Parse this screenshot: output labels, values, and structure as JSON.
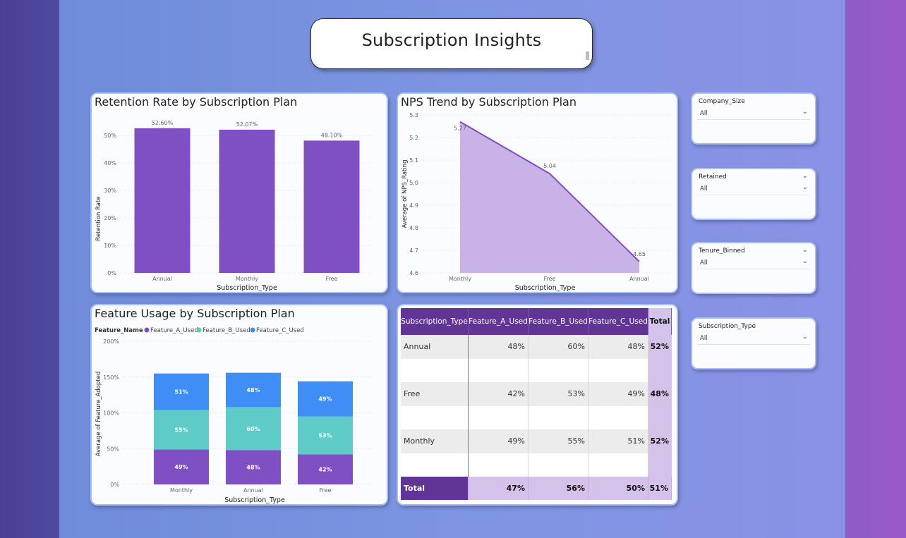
{
  "page_title": "Subscription Insights",
  "colors": {
    "purple": "#7f4fc4",
    "teal": "#5ecbc6",
    "blue": "#3f8ef6",
    "header": "#613596",
    "total": "#d4c2ea",
    "area": "#c8b2e6"
  },
  "retention": {
    "title": "Retention Rate by Subscription Plan",
    "chart_data": {
      "type": "bar",
      "categories": [
        "Annual",
        "Monthly",
        "Free"
      ],
      "values": [
        52.6,
        52.07,
        48.1
      ],
      "data_labels": [
        "52.60%",
        "52.07%",
        "48.10%"
      ],
      "xlabel": "Subscription_Type",
      "ylabel": "Retention Rate",
      "ylim": [
        0,
        60
      ],
      "yticks": [
        "0%",
        "10%",
        "20%",
        "30%",
        "40%",
        "50%"
      ]
    }
  },
  "nps": {
    "title": "NPS Trend by Subscription Plan",
    "chart_data": {
      "type": "area",
      "categories": [
        "Monthly",
        "Free",
        "Annual"
      ],
      "values": [
        5.27,
        5.04,
        4.65
      ],
      "data_labels": [
        "5.27",
        "5.04",
        "4.65"
      ],
      "xlabel": "Subscription_Type",
      "ylabel": "Average of NPS_Rating",
      "ylim": [
        4.6,
        5.3
      ],
      "yticks": [
        "4.6",
        "4.7",
        "4.8",
        "4.9",
        "5.0",
        "5.1",
        "5.2",
        "5.3"
      ]
    }
  },
  "feature": {
    "title": "Feature Usage by Subscription Plan",
    "legend_title": "Feature_Name",
    "chart_data": {
      "type": "bar",
      "stacked": true,
      "categories": [
        "Monthly",
        "Annual",
        "Free"
      ],
      "series": [
        {
          "name": "Feature_A_Used",
          "values": [
            49,
            48,
            42
          ]
        },
        {
          "name": "Feature_B_Used",
          "values": [
            55,
            60,
            53
          ]
        },
        {
          "name": "Feature_C_Used",
          "values": [
            51,
            48,
            49
          ]
        }
      ],
      "xlabel": "Subscription_Type",
      "ylabel": "Average of Feature_Adopted",
      "ylim": [
        0,
        200
      ],
      "yticks": [
        "0%",
        "50%",
        "100%",
        "150%",
        "200%"
      ],
      "legend_position": "top-left"
    }
  },
  "matrix": {
    "headers": [
      "Subscription_Type",
      "Feature_A_Used",
      "Feature_B_Used",
      "Feature_C_Used",
      "Total"
    ],
    "rows": [
      [
        "Annual",
        "48%",
        "60%",
        "48%",
        "52%"
      ],
      [
        "Free",
        "42%",
        "53%",
        "49%",
        "48%"
      ],
      [
        "Monthly",
        "49%",
        "55%",
        "51%",
        "52%"
      ]
    ],
    "total": [
      "Total",
      "47%",
      "56%",
      "50%",
      "51%"
    ]
  },
  "slicers": [
    {
      "label": "Company_Size",
      "value": "All",
      "header_chevron": false
    },
    {
      "label": "Retained",
      "value": "All",
      "header_chevron": true
    },
    {
      "label": "Tenure_Binned",
      "value": "All",
      "header_chevron": true
    },
    {
      "label": "Subscription_Type",
      "value": "All",
      "header_chevron": false
    }
  ]
}
